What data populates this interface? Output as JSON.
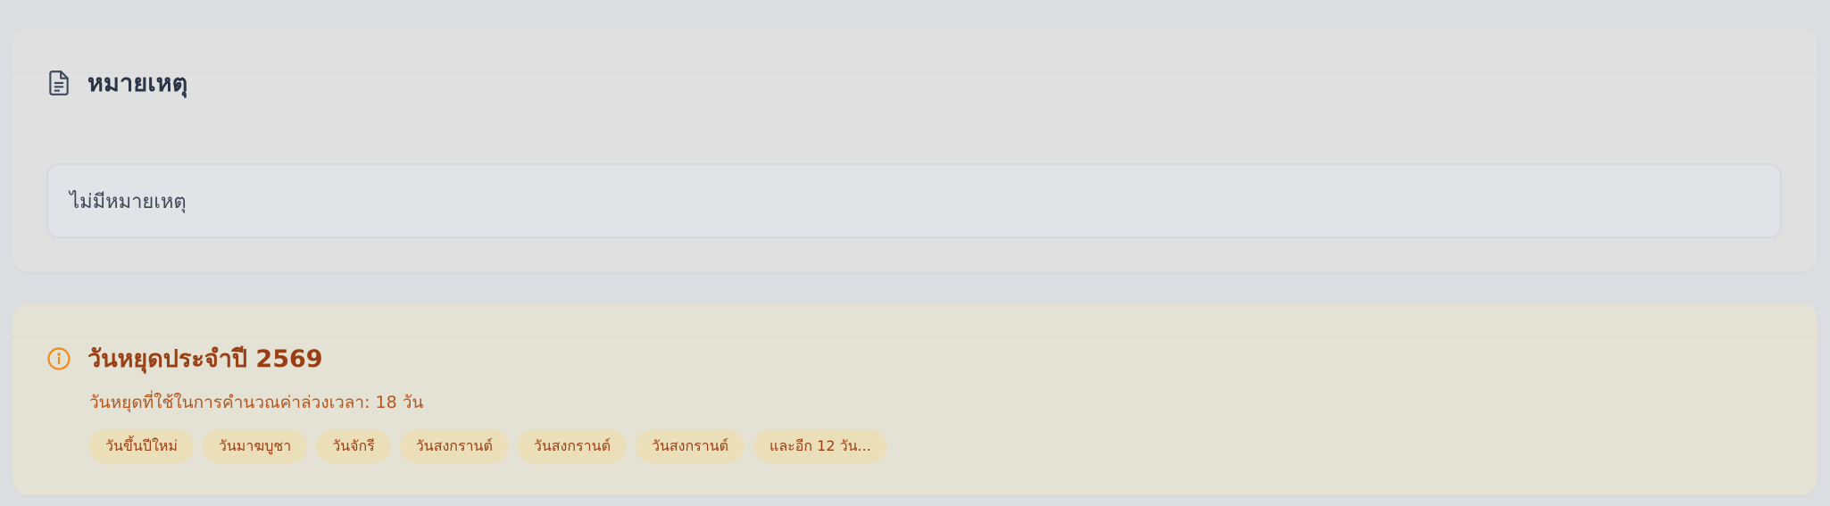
{
  "notes": {
    "title": "หมายเหตุ",
    "icon": "document-icon",
    "content": "ไม่มีหมายเหตุ"
  },
  "holidays": {
    "title": "วันหยุดประจำปี 2569",
    "icon": "info-icon",
    "subtitle": "วันหยุดที่ใช้ในการคำนวณค่าล่วงเวลา: 18 วัน",
    "chips": [
      "วันขึ้นปีใหม่",
      "วันมาฆบูชา",
      "วันจักรี",
      "วันสงกรานต์",
      "วันสงกรานต์",
      "วันสงกรานต์",
      "และอีก 12 วัน..."
    ]
  },
  "colors": {
    "background": "#dcdde0",
    "notes_card": "#e0e0e1",
    "holiday_card": "#e3e2d5",
    "holiday_accent": "#9a3f14",
    "holiday_icon": "#f08a1c",
    "chip_background": "#eadfb8"
  }
}
